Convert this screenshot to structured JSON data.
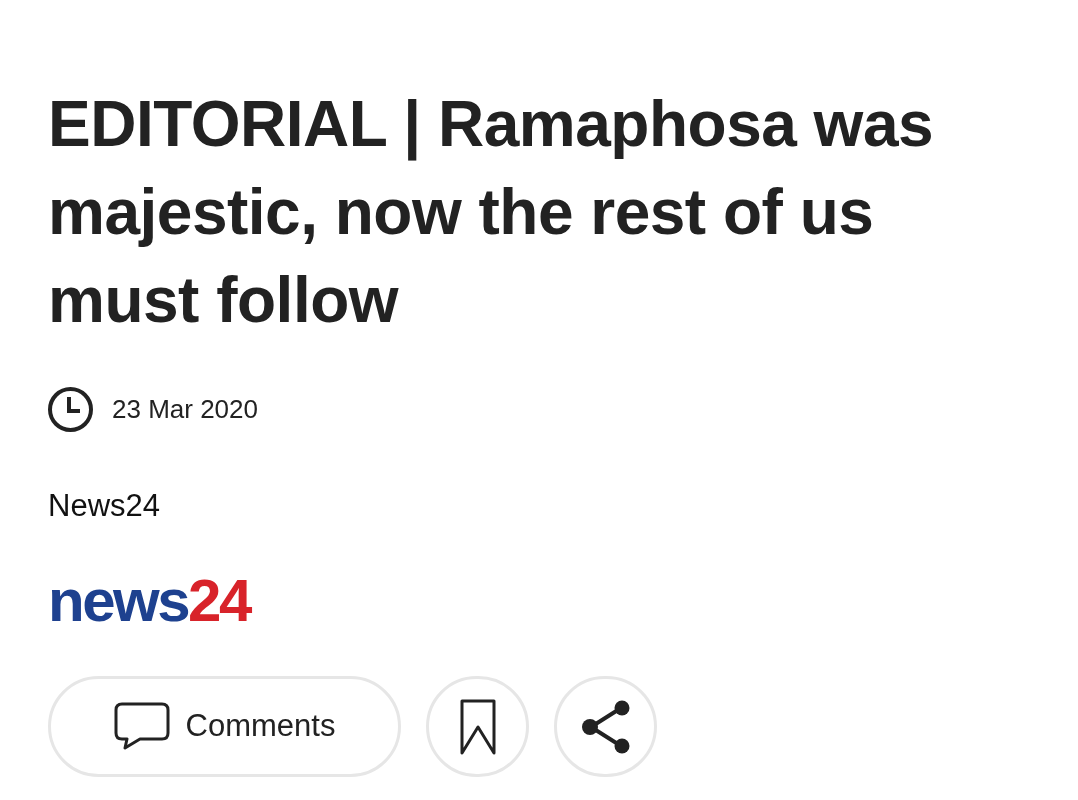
{
  "headline": "EDITORIAL | Ramaphosa was majestic, now the rest of us must follow",
  "date": "23 Mar 2020",
  "source": "News24",
  "logo": {
    "parts": [
      {
        "text": "news",
        "color": "#1e418f"
      },
      {
        "text": "24",
        "color": "#d8232a"
      }
    ]
  },
  "actions": [
    {
      "kind": "comments",
      "label": "Comments"
    },
    {
      "kind": "bookmark"
    },
    {
      "kind": "share"
    }
  ]
}
